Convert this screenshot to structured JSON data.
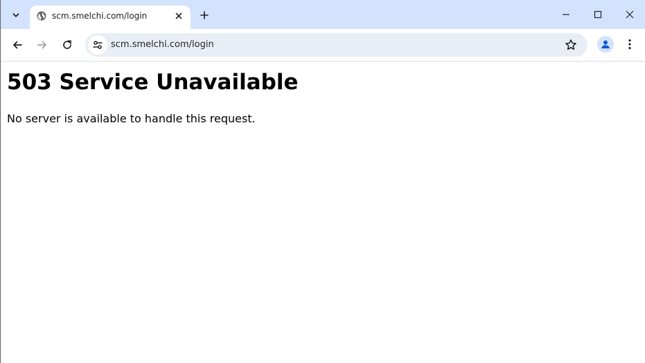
{
  "browser": {
    "tab": {
      "title": "scm.smelchi.com/login",
      "favicon": "globe-icon"
    },
    "address_bar": {
      "url": "scm.smelchi.com/login"
    },
    "icons": {
      "tab_search": "chevron-down-icon",
      "tab_close": "close-icon",
      "new_tab": "plus-icon",
      "minimize": "minimize-icon",
      "maximize": "maximize-icon",
      "close_window": "close-icon",
      "back": "arrow-left-icon",
      "forward": "arrow-right-icon",
      "reload": "reload-icon",
      "site_info": "tune-icon",
      "bookmark": "star-icon",
      "profile": "person-icon",
      "menu": "more-vert-icon"
    },
    "colors": {
      "tabstrip": "#d3e3fd",
      "omnibox": "#e9eef6",
      "profile_accent": "#0b57d0"
    }
  },
  "page": {
    "heading": "503 Service Unavailable",
    "message": "No server is available to handle this request."
  }
}
